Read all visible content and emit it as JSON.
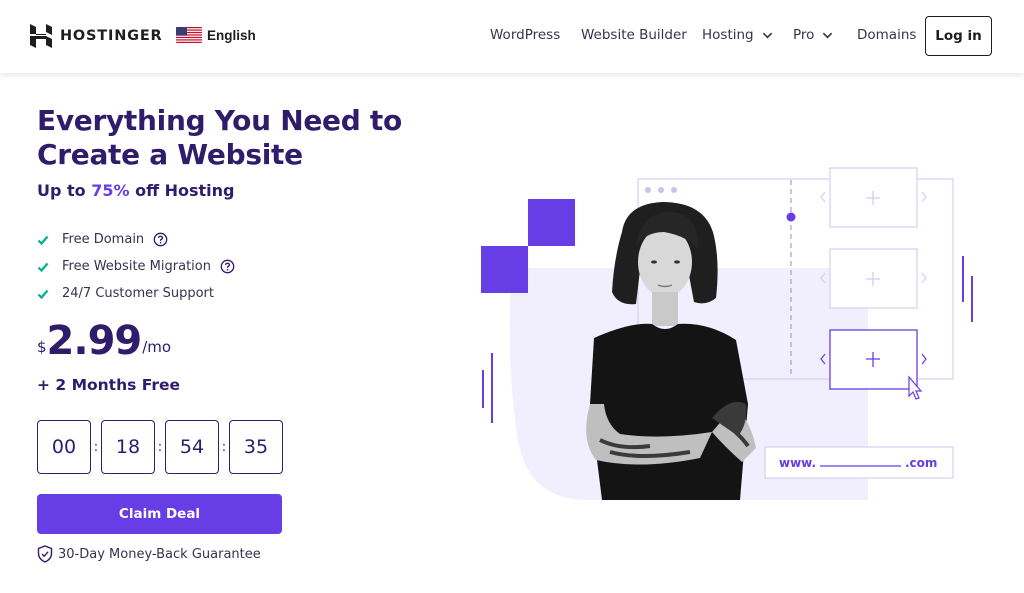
{
  "header": {
    "brand": "HOSTINGER",
    "language": "English",
    "nav": [
      {
        "label": "WordPress",
        "dropdown": false
      },
      {
        "label": "Website Builder",
        "dropdown": false
      },
      {
        "label": "Hosting",
        "dropdown": true
      },
      {
        "label": "Pro",
        "dropdown": true
      },
      {
        "label": "Domains",
        "dropdown": false
      }
    ],
    "login_label": "Log in"
  },
  "hero": {
    "headline_line1": "Everything You Need to",
    "headline_line2": "Create a Website",
    "subhead_prefix": "Up to ",
    "subhead_accent": "75%",
    "subhead_suffix": " off Hosting",
    "features": [
      {
        "label": "Free Domain",
        "help": true
      },
      {
        "label": "Free Website Migration",
        "help": true
      },
      {
        "label": "24/7 Customer Support",
        "help": false
      }
    ],
    "price": {
      "currency": "$",
      "amount": "2.99",
      "period": "/mo"
    },
    "bonus": "+ 2 Months Free",
    "timer": {
      "days": "00",
      "hours": "18",
      "minutes": "54",
      "seconds": "35"
    },
    "cta_label": "Claim Deal",
    "guarantee": "30-Day Money-Back Guarantee"
  },
  "illustration": {
    "url_prefix": "www.",
    "url_suffix": ".com"
  },
  "colors": {
    "primary": "#673de6",
    "heading": "#2f1c6a",
    "check": "#00b090",
    "lavender": "#f1eefd"
  },
  "icons": [
    "hostinger-logo-icon",
    "us-flag-icon",
    "chevron-down-icon",
    "check-icon",
    "help-icon",
    "shield-check-icon",
    "plus-icon",
    "cursor-icon"
  ]
}
